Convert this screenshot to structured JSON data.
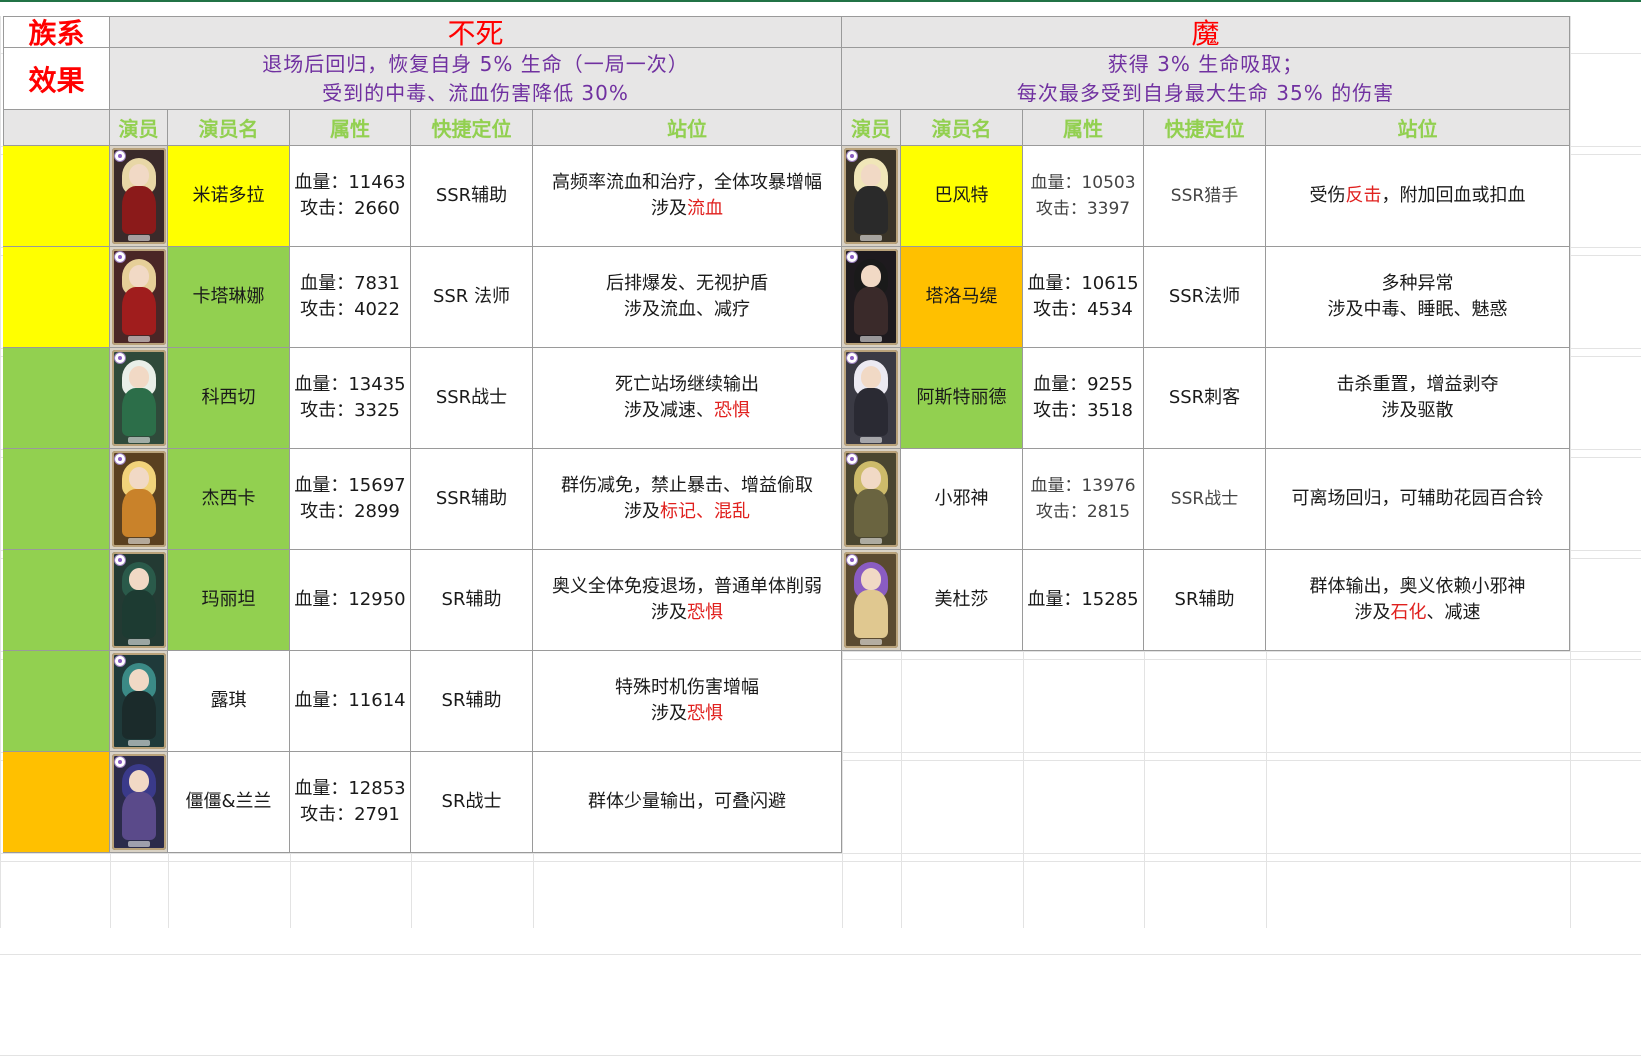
{
  "colors": {
    "yellow": "#ffff00",
    "green": "#92d050",
    "orange": "#ffc000",
    "header_gray": "#e7e6e6",
    "title_red": "#ff0000",
    "effect_purple": "#7030a0",
    "colhdr_green": "#92d050",
    "highlight_red": "#e0201e"
  },
  "row_labels": {
    "faction": "族系",
    "effect": "效果"
  },
  "factions": [
    {
      "name": "不死",
      "effect_lines": [
        "退场后回归，恢复自身 5% 生命（一局一次）",
        "受到的中毒、流血伤害降低 30%"
      ],
      "columns": [
        "演员",
        "演员名",
        "属性",
        "快捷定位",
        "站位"
      ],
      "rows": [
        {
          "row_fill": "#ffff00",
          "name_fill": "#ffff00",
          "portrait": {
            "bg": "#3a2a2a",
            "hair": "#e8d7a6",
            "outfit": "#8b1a1a"
          },
          "name": "米诺多拉",
          "stats": [
            "血量：11463",
            "攻击：2660"
          ],
          "role": "SSR辅助",
          "position": [
            "高频率流血和治疗，全体攻暴增幅",
            "涉及",
            "流血",
            ""
          ]
        },
        {
          "row_fill": "#ffff00",
          "name_fill": "#92d050",
          "portrait": {
            "bg": "#4a2626",
            "hair": "#e6cf98",
            "outfit": "#a01d1d"
          },
          "name": "卡塔琳娜",
          "stats": [
            "血量：7831",
            "攻击：4022"
          ],
          "role": "SSR 法师",
          "position": [
            "后排爆发、无视护盾",
            "涉及流血、减疗",
            "",
            ""
          ]
        },
        {
          "row_fill": "#92d050",
          "name_fill": "#92d050",
          "portrait": {
            "bg": "#2f4a3a",
            "hair": "#e9efe8",
            "outfit": "#2c6e49"
          },
          "name": "科西切",
          "stats": [
            "血量：13435",
            "攻击：3325"
          ],
          "role": "SSR战士",
          "position": [
            "死亡站场继续输出",
            "涉及减速、",
            "恐惧",
            ""
          ]
        },
        {
          "row_fill": "#92d050",
          "name_fill": "#92d050",
          "portrait": {
            "bg": "#5a4020",
            "hair": "#f2d37a",
            "outfit": "#c9822a"
          },
          "name": "杰西卡",
          "stats": [
            "血量：15697",
            "攻击：2899"
          ],
          "role": "SSR辅助",
          "position": [
            "群伤减免，禁止暴击、增益偷取",
            "涉及",
            "标记、混乱",
            ""
          ]
        },
        {
          "row_fill": "#92d050",
          "name_fill": "#92d050",
          "portrait": {
            "bg": "#233a33",
            "hair": "#2a5a4a",
            "outfit": "#1d3b32"
          },
          "name": "玛丽坦",
          "stats": [
            "血量：12950"
          ],
          "role": "SR辅助",
          "position": [
            "奥义全体免疫退场，普通单体削弱",
            "涉及",
            "恐惧",
            ""
          ]
        },
        {
          "row_fill": "#92d050",
          "name_fill": "#ffffff",
          "portrait": {
            "bg": "#1f3a3a",
            "hair": "#3b8a86",
            "outfit": "#1b2b2b"
          },
          "name": "露琪",
          "stats": [
            "血量：11614"
          ],
          "role": "SR辅助",
          "position": [
            "特殊时机伤害增幅",
            "涉及",
            "恐惧",
            ""
          ]
        },
        {
          "row_fill": "#ffc000",
          "name_fill": "#ffffff",
          "portrait": {
            "bg": "#2b2b4a",
            "hair": "#3a3a8a",
            "outfit": "#5a4a8a"
          },
          "name": "僵僵&兰兰",
          "stats": [
            "血量：12853",
            "攻击：2791"
          ],
          "role": "SR战士",
          "position": [
            "群体少量输出，可叠闪避",
            "",
            "",
            ""
          ]
        }
      ]
    },
    {
      "name": "魔",
      "effect_lines": [
        "获得 3% 生命吸取；",
        "每次最多受到自身最大生命 35% 的伤害"
      ],
      "columns": [
        "演员",
        "演员名",
        "属性",
        "快捷定位",
        "站位"
      ],
      "rows": [
        {
          "name_fill": "#ffff00",
          "portrait": {
            "bg": "#3a3428",
            "hair": "#f0e6b8",
            "outfit": "#2a2a2a"
          },
          "name": "巴风特",
          "stats": [
            "血量：10503",
            "攻击：3397"
          ],
          "stats_light": true,
          "role": "SSR猎手",
          "role_light": true,
          "position": [
            "受伤",
            "反击",
            "，附加回血或扣血",
            "single"
          ]
        },
        {
          "name_fill": "#ffc000",
          "portrait": {
            "bg": "#1e1a1e",
            "hair": "#1a1a1a",
            "outfit": "#3a2a2a"
          },
          "name": "塔洛马缇",
          "stats": [
            "血量：10615",
            "攻击：4534"
          ],
          "role": "SSR法师",
          "position": [
            "多种异常",
            "涉及中毒、睡眠、魅惑",
            "",
            ""
          ]
        },
        {
          "name_fill": "#92d050",
          "portrait": {
            "bg": "#3a3a44",
            "hair": "#eceaf2",
            "outfit": "#2a2a33"
          },
          "name": "阿斯特丽德",
          "stats": [
            "血量：9255",
            "攻击：3518"
          ],
          "role": "SSR刺客",
          "position": [
            "击杀重置，增益剥夺",
            "涉及驱散",
            "",
            ""
          ]
        },
        {
          "name_fill": "#ffffff",
          "portrait": {
            "bg": "#4a4630",
            "hair": "#cdbb6a",
            "outfit": "#6a6440"
          },
          "name": "小邪神",
          "stats": [
            "血量：13976",
            "攻击：2815"
          ],
          "stats_light": true,
          "role": "SSR战士",
          "role_light": true,
          "position": [
            "可离场回归，可辅助花园百合铃",
            "",
            "",
            "plain"
          ]
        },
        {
          "name_fill": "#ffffff",
          "portrait": {
            "bg": "#5a4a30",
            "hair": "#8a5cc2",
            "outfit": "#e0c890"
          },
          "name": "美杜莎",
          "stats": [
            "血量：15285"
          ],
          "role": "SR辅助",
          "position": [
            "群体输出，奥义依赖小邪神",
            "涉及",
            "石化",
            "、减速"
          ]
        }
      ]
    }
  ]
}
